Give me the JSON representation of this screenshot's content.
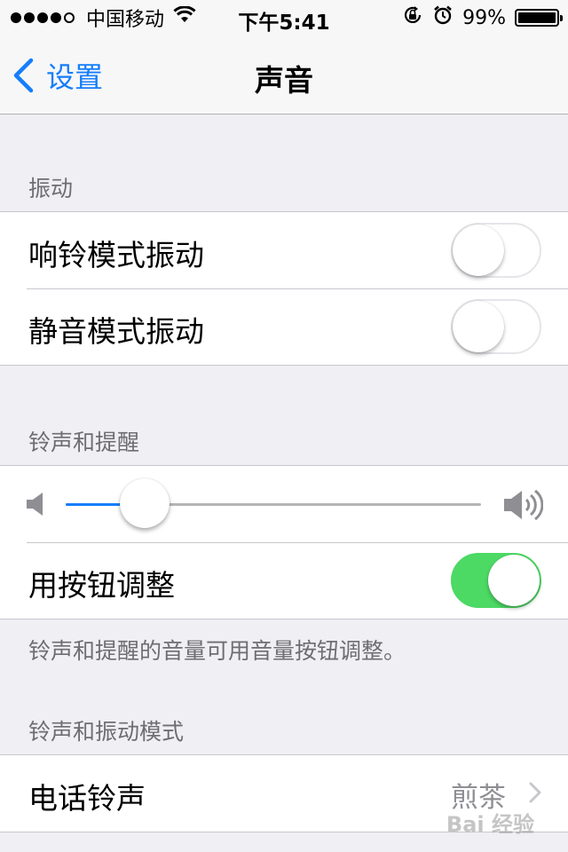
{
  "status_bar": {
    "carrier": "中国移动",
    "time": "下午5:41",
    "battery": "99%",
    "battery_level": 0.99,
    "icons": [
      "signal-dots",
      "wifi-icon",
      "rotation-lock-icon",
      "alarm-icon",
      "battery-icon"
    ]
  },
  "nav": {
    "back_label": "设置",
    "title": "声音"
  },
  "vibrate": {
    "header": "振动",
    "ring_label": "响铃模式振动",
    "ring_on": false,
    "silent_label": "静音模式振动",
    "silent_on": false
  },
  "ringer": {
    "header": "铃声和提醒",
    "volume_fraction": 0.19,
    "buttons_label": "用按钮调整",
    "buttons_on": true,
    "footnote": "铃声和提醒的音量可用音量按钮调整。"
  },
  "patterns": {
    "header": "铃声和振动模式",
    "ringtone_label": "电话铃声",
    "ringtone_value": "煎茶"
  },
  "watermark": "Bai 经验",
  "colors": {
    "accent": "#157efb",
    "toggle_on": "#4cd964",
    "background": "#efeff4"
  }
}
